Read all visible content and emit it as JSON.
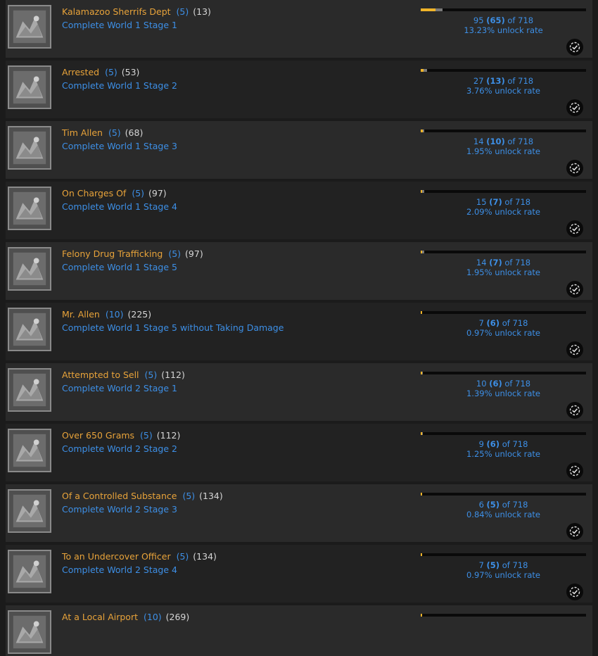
{
  "accent": {
    "gold": "#f0b429",
    "blue": "#3d8fe6",
    "row_odd": "#2a2a2a",
    "row_even": "#222222"
  },
  "total_players": "718",
  "of_label": "of",
  "rate_suffix": "unlock rate",
  "achievements": [
    {
      "title": "Kalamazoo Sherrifs Dept",
      "points": "(5)",
      "count": "(13)",
      "description": "Complete World 1 Stage 1",
      "unlocked": "95",
      "hardcore": "(65)",
      "rate": "13.23%",
      "fill_total": 0.1323,
      "fill_hard": 0.0905,
      "icon": "dragon-head-icon"
    },
    {
      "title": "Arrested",
      "points": "(5)",
      "count": "(53)",
      "description": "Complete World 1 Stage 2",
      "unlocked": "27",
      "hardcore": "(13)",
      "rate": "3.76%",
      "fill_total": 0.0376,
      "fill_hard": 0.0181,
      "icon": "dinosaur-icon"
    },
    {
      "title": "Tim Allen",
      "points": "(5)",
      "count": "(68)",
      "description": "Complete World 1 Stage 3",
      "unlocked": "14",
      "hardcore": "(10)",
      "rate": "1.95%",
      "fill_total": 0.0195,
      "fill_hard": 0.0139,
      "icon": "stage-map-icon"
    },
    {
      "title": "On Charges Of",
      "points": "(5)",
      "count": "(97)",
      "description": "Complete World 1 Stage 4",
      "unlocked": "15",
      "hardcore": "(7)",
      "rate": "2.09%",
      "fill_total": 0.0209,
      "fill_hard": 0.0097,
      "icon": "triceratops-icon"
    },
    {
      "title": "Felony Drug Trafficking",
      "points": "(5)",
      "count": "(97)",
      "description": "Complete World 1 Stage 5",
      "unlocked": "14",
      "hardcore": "(7)",
      "rate": "1.95%",
      "fill_total": 0.0195,
      "fill_hard": 0.0097,
      "icon": "beast-icon"
    },
    {
      "title": "Mr. Allen",
      "points": "(10)",
      "count": "(225)",
      "description": "Complete World 1 Stage 5 without Taking Damage",
      "unlocked": "7",
      "hardcore": "(6)",
      "rate": "0.97%",
      "fill_total": 0.0097,
      "fill_hard": 0.0084,
      "icon": "monster-icon"
    },
    {
      "title": "Attempted to Sell",
      "points": "(5)",
      "count": "(112)",
      "description": "Complete World 2 Stage 1",
      "unlocked": "10",
      "hardcore": "(6)",
      "rate": "1.39%",
      "fill_total": 0.0139,
      "fill_hard": 0.0084,
      "icon": "city-scene-icon"
    },
    {
      "title": "Over 650 Grams",
      "points": "(5)",
      "count": "(112)",
      "description": "Complete World 2 Stage 2",
      "unlocked": "9",
      "hardcore": "(6)",
      "rate": "1.25%",
      "fill_total": 0.0125,
      "fill_hard": 0.0084,
      "icon": "brick-wall-icon"
    },
    {
      "title": "Of a Controlled Substance",
      "points": "(5)",
      "count": "(134)",
      "description": "Complete World 2 Stage 3",
      "unlocked": "6",
      "hardcore": "(5)",
      "rate": "0.84%",
      "fill_total": 0.0084,
      "fill_hard": 0.007,
      "icon": "creature-icon"
    },
    {
      "title": "To an Undercover Officer",
      "points": "(5)",
      "count": "(134)",
      "description": "Complete World 2 Stage 4",
      "unlocked": "7",
      "hardcore": "(5)",
      "rate": "0.97%",
      "fill_total": 0.0097,
      "fill_hard": 0.007,
      "icon": "reptile-icon"
    },
    {
      "title": "At a Local Airport",
      "points": "(10)",
      "count": "(269)",
      "description": "",
      "unlocked": "",
      "hardcore": "",
      "rate": "",
      "fill_total": 0.0097,
      "fill_hard": 0.007,
      "icon": "airport-icon"
    }
  ]
}
